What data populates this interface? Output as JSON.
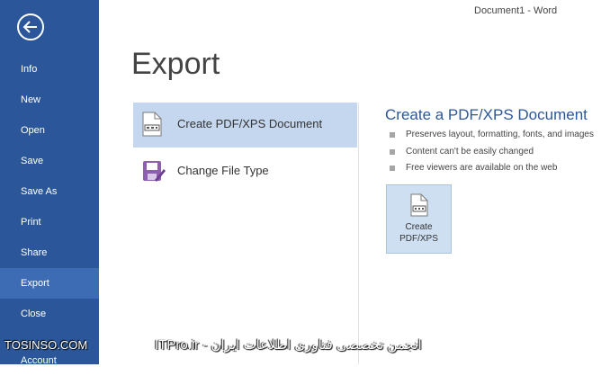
{
  "window": {
    "title": "Document1 - Word"
  },
  "sidebar": {
    "back_icon": "back-arrow-icon",
    "items": [
      {
        "label": "Info"
      },
      {
        "label": "New"
      },
      {
        "label": "Open"
      },
      {
        "label": "Save"
      },
      {
        "label": "Save As"
      },
      {
        "label": "Print"
      },
      {
        "label": "Share"
      },
      {
        "label": "Export",
        "active": true
      },
      {
        "label": "Close"
      },
      {
        "label": "Account"
      }
    ],
    "colors": {
      "background": "#2b579a",
      "active": "#3d6cb5"
    }
  },
  "main": {
    "title": "Export",
    "options": [
      {
        "label": "Create PDF/XPS Document",
        "icon": "pdf-document-icon",
        "selected": true
      },
      {
        "label": "Change File Type",
        "icon": "change-file-type-icon",
        "selected": false
      }
    ]
  },
  "detail": {
    "title": "Create a PDF/XPS Document",
    "bullets": [
      "Preserves layout, formatting, fonts, and images",
      "Content can't be easily changed",
      "Free viewers are available on the web"
    ],
    "button": {
      "line1": "Create",
      "line2": "PDF/XPS",
      "icon": "pdf-document-icon"
    }
  },
  "watermark": {
    "left": "TOSINSO.COM",
    "center": "ITPro.ir - انجمن تخصصی فناوری اطلاعات ایران"
  }
}
